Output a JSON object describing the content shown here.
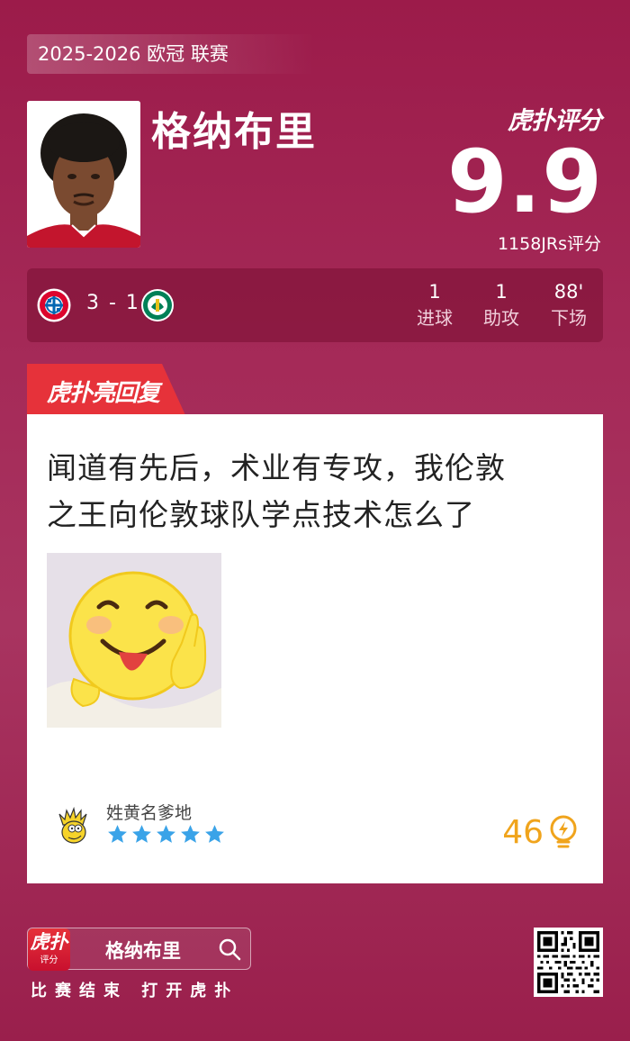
{
  "header": {
    "league_label": "2025-2026 欧冠 联赛",
    "player_name": "格纳布里",
    "brand_logo": "虎扑评分",
    "score": "9.9",
    "rating_count_label": "1158JRs评分"
  },
  "match": {
    "home_team_icon": "bayern-munich-crest",
    "away_team_icon": "sporting-cp-crest",
    "score": "3 - 1",
    "stats": [
      {
        "value": "1",
        "label": "进球"
      },
      {
        "value": "1",
        "label": "助攻"
      },
      {
        "value": "88'",
        "label": "下场"
      }
    ]
  },
  "reply": {
    "tab_label": "虎扑亮回复",
    "comment_line1": "闻道有先后，术业有专攻，我伦敦",
    "comment_line2": "之王向伦敦球队学点技术怎么了",
    "image_icon": "smiley-tongue-thumbs-up",
    "user_name": "姓黄名爹地",
    "user_stars": 5,
    "likes": "46",
    "colors": {
      "star": "#3aa3e8",
      "likes": "#f0a41c"
    }
  },
  "footer": {
    "app_icon_top": "虎扑",
    "app_icon_bottom": "评分",
    "search_name": "格纳布里",
    "caption": "比赛结束 打开虎扑"
  },
  "colors": {
    "background": "#a52a58",
    "tab_red": "#e6323a"
  }
}
